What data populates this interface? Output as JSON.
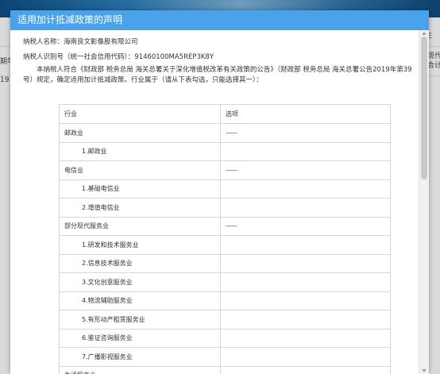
{
  "background": {
    "left_texts": [
      "期年度",
      "19"
    ],
    "right_texts": [
      "现代",
      "合计"
    ],
    "right_marker": "E"
  },
  "dialog": {
    "title": "适用加计抵减政策的声明",
    "taxpayer_name_label": "纳税人名称：海南良文影像股有限公司",
    "taxpayer_id_label": "纳税人识别号（统一社会信用代码）：91460100MA5REP3K8Y",
    "declaration_line1": "本纳税人符合《财政部 税务总局 海关总署关于深化增值税改革有关政策的公告》（财政部 税务总局 海关总署公告2019年第39号）规",
    "declaration_line2": "定，确定适用加计抵减政策。行业属于（请从下表勾选，只能选择其一）：",
    "table": {
      "headers": [
        "行业",
        "选项"
      ],
      "rows": [
        {
          "industry": "邮政业",
          "option": "——",
          "sub": false
        },
        {
          "industry": "1.邮政业",
          "option": "",
          "sub": true
        },
        {
          "industry": "电信业",
          "option": "——",
          "sub": false
        },
        {
          "industry": "1.基础电信业",
          "option": "",
          "sub": true
        },
        {
          "industry": "2.增值电信业",
          "option": "",
          "sub": true
        },
        {
          "industry": "部分现代服务业",
          "option": "——",
          "sub": false
        },
        {
          "industry": "1.研发和技术服务业",
          "option": "",
          "sub": true
        },
        {
          "industry": "2.信息技术服务业",
          "option": "",
          "sub": true
        },
        {
          "industry": "3.文化创意服务业",
          "option": "",
          "sub": true
        },
        {
          "industry": "4.物流辅助服务业",
          "option": "",
          "sub": true
        },
        {
          "industry": "5.有形动产租赁服务业",
          "option": "",
          "sub": true
        },
        {
          "industry": "6.鉴证咨询服务业",
          "option": "",
          "sub": true
        },
        {
          "industry": "7.广播影视服务业",
          "option": "",
          "sub": true
        },
        {
          "industry": "生活服务业",
          "option": "——",
          "sub": false
        }
      ]
    }
  },
  "colors": {
    "title_bar": "#4aa3ea",
    "border": "#d7d7d7"
  }
}
